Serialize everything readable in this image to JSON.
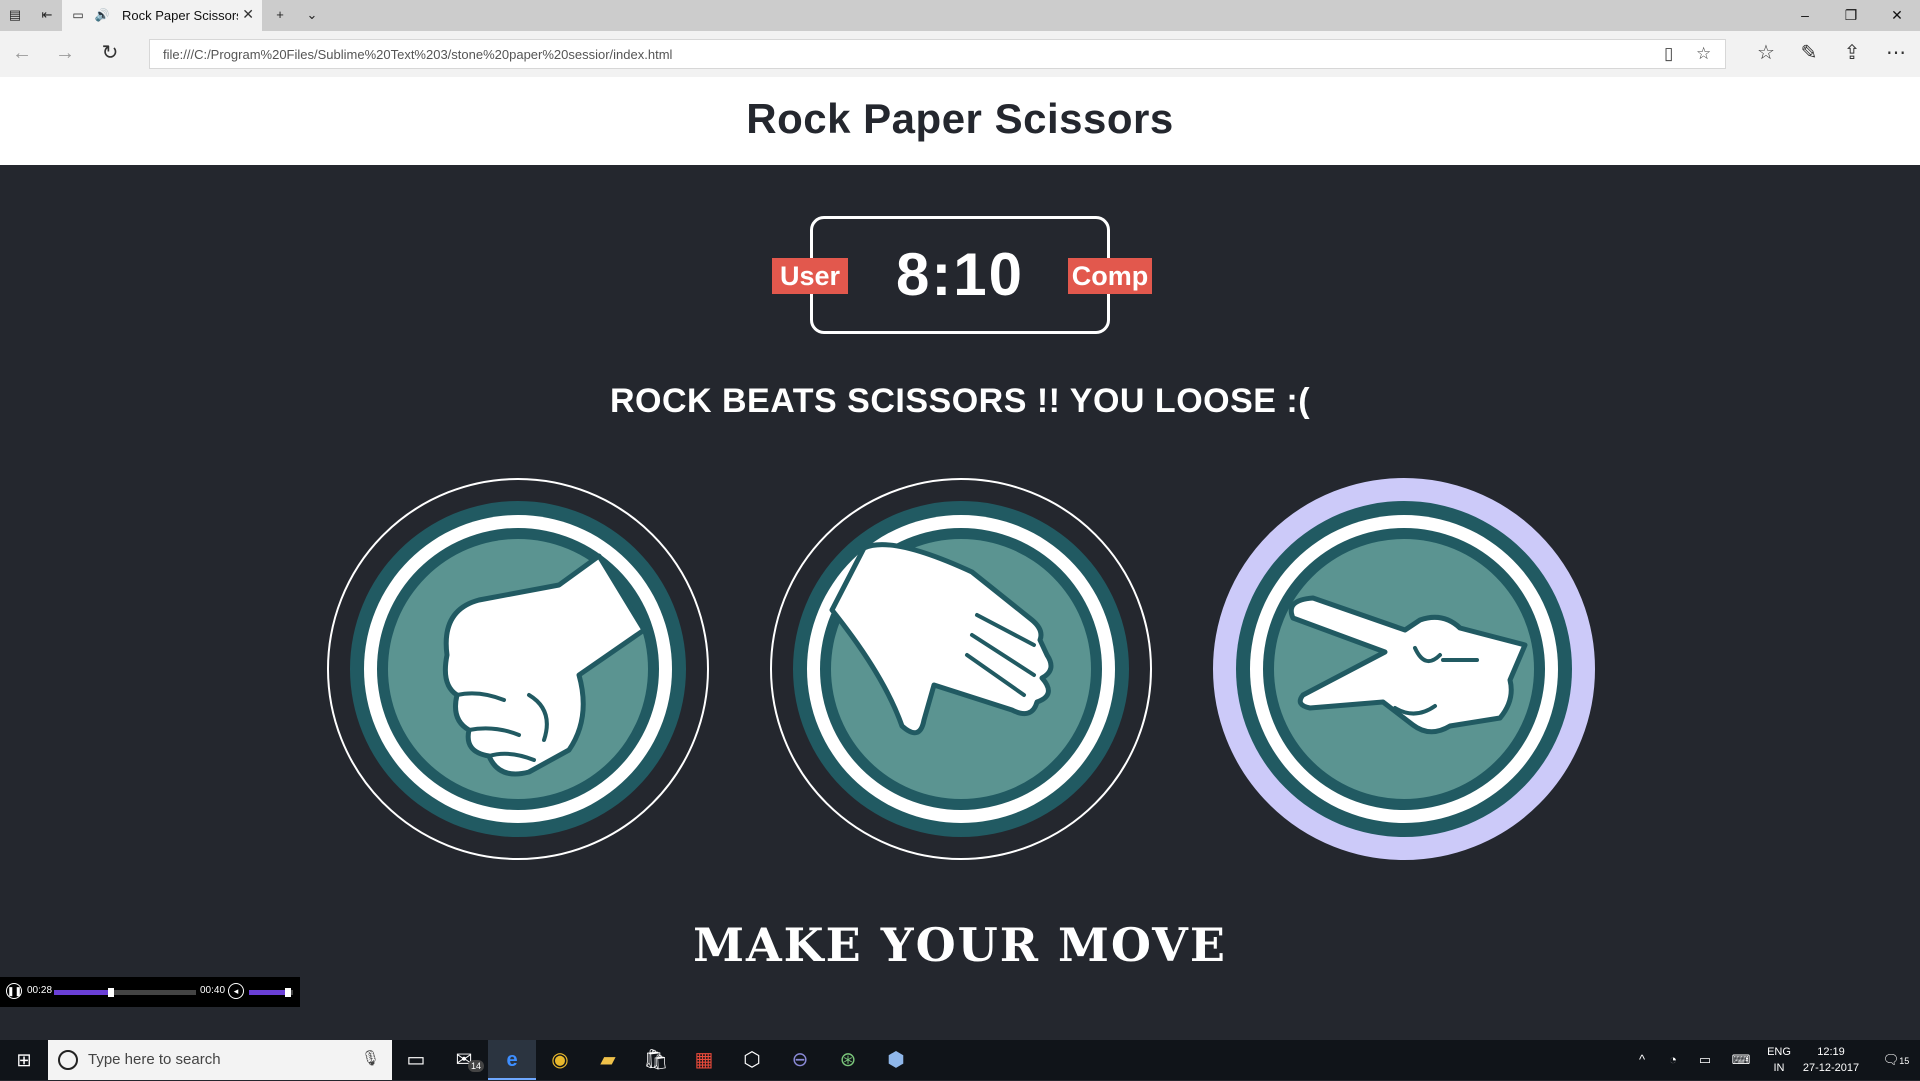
{
  "browser": {
    "tab_title": "Rock Paper Scissors",
    "address": "file:///C:/Program%20Files/Sublime%20Text%203/stone%20paper%20sessior/index.html",
    "icons": [
      "tab-list-icon",
      "set-aside-tabs-icon",
      "page-icon",
      "speaker-icon",
      "close-icon",
      "new-tab-icon",
      "chevron-down-icon",
      "minimize-icon",
      "restore-icon",
      "close-window-icon",
      "back-icon",
      "forward-icon",
      "refresh-icon",
      "reading-view-icon",
      "favorite-star-icon",
      "favorites-hub-icon",
      "pen-icon",
      "share-icon",
      "more-icon"
    ]
  },
  "page": {
    "title": "Rock Paper Scissors",
    "user_label": "User",
    "comp_label": "Comp",
    "score": "8:10",
    "result_message": "ROCK BEATS SCISSORS !! YOU LOOSE :(",
    "action_message": "MAKE YOUR MOVE",
    "choices": [
      {
        "name": "rock",
        "icon": "rock-fist-icon",
        "selected": false
      },
      {
        "name": "paper",
        "icon": "paper-hand-icon",
        "selected": false
      },
      {
        "name": "scissors",
        "icon": "scissors-hand-icon",
        "selected": true
      }
    ],
    "colors": {
      "background": "#24272e",
      "badge": "#e2584d",
      "selected_ring": "#cccaf9",
      "icon_teal": "#5b9491",
      "icon_dark": "#215a62"
    }
  },
  "media": {
    "current_time": "00:28",
    "total_time": "00:40",
    "progress": 0.4,
    "volume": 0.95
  },
  "taskbar": {
    "search_placeholder": "Type here to search",
    "mail_badge": "14",
    "language_top": "ENG",
    "language_bottom": "IN",
    "time": "12:19",
    "date": "27-12-2017",
    "notifications": "15"
  }
}
